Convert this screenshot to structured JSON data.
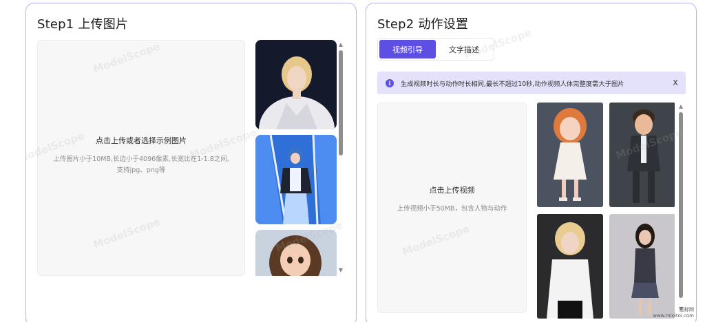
{
  "step1": {
    "title": "Step1 上传图片",
    "upload_main": "点击上传或者选择示例图片",
    "upload_hint": "上传图片小于10MB,长边小于4096像素,长宽比在1-1.8之间,支持jpg、png等"
  },
  "step2": {
    "title": "Step2 动作设置",
    "tabs": [
      {
        "label": "视频引导",
        "active": true
      },
      {
        "label": "文字描述",
        "active": false
      }
    ],
    "notice": {
      "text": "生成视频时长与动作时长相同,最长不超过10秒,动作视频人体完整度需大于图片",
      "close": "X"
    },
    "upload_main": "点击上传视频",
    "upload_hint": "上传视频小于50MB，包含人物与动作"
  },
  "watermark_text": "ModelScope",
  "corner_logo": [
    "图标网",
    "www.mioitoi.com"
  ],
  "colors": {
    "accent": "#5d4fe3",
    "panel_border": "#b7b2ee",
    "notice_bg": "#e4e2fb"
  }
}
